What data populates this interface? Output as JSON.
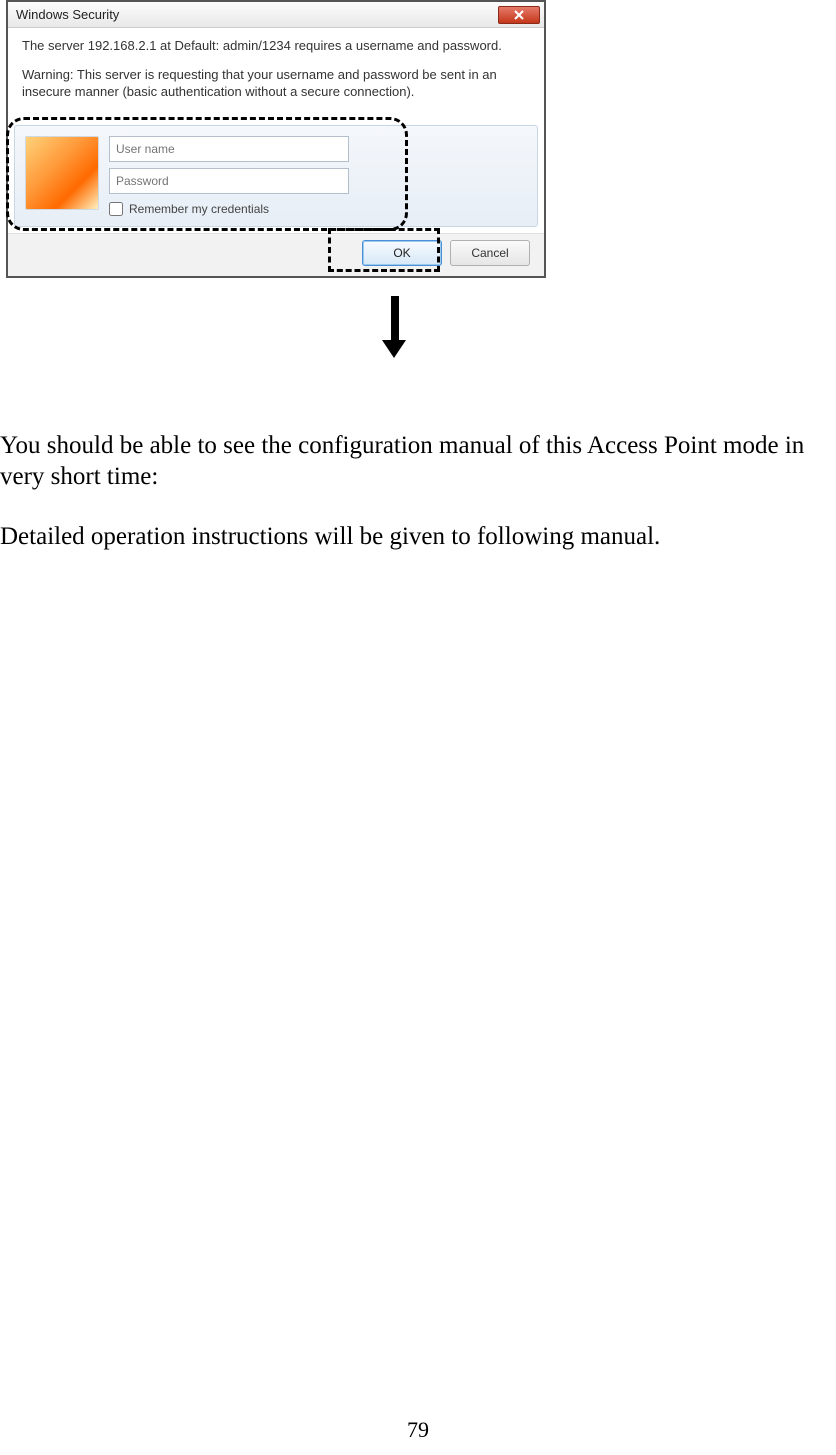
{
  "dialog": {
    "title": "Windows Security",
    "message": "The server 192.168.2.1 at Default: admin/1234 requires a username and password.",
    "warning": "Warning: This server is requesting that your username and password be sent in an insecure manner (basic authentication without a secure connection).",
    "username_placeholder": "User name",
    "password_placeholder": "Password",
    "remember_label": "Remember my credentials",
    "ok_label": "OK",
    "cancel_label": "Cancel"
  },
  "doc": {
    "para1": "You should be able to see the configuration manual of this Access Point mode in very short time:",
    "para2": "Detailed operation instructions will be given to following manual."
  },
  "page_number": "79"
}
